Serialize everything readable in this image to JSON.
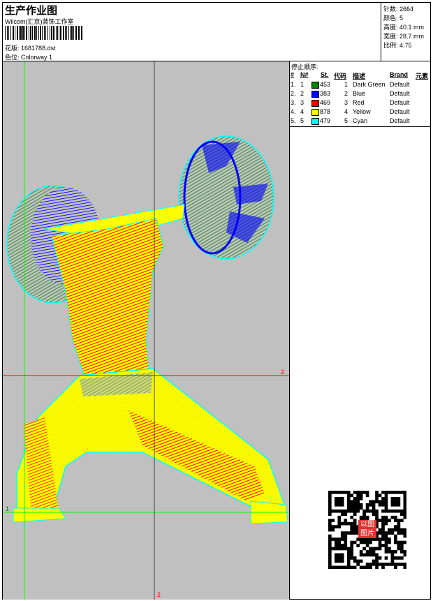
{
  "header": {
    "title": "生产作业图",
    "company": "Wilcom(汇京)装饰工作室",
    "design_label": "花版:",
    "design_value": "1681788.dst",
    "colorway_label": "色位:",
    "colorway_value": "Colorway 1"
  },
  "stats": [
    {
      "label": "针数:",
      "value": "2664"
    },
    {
      "label": "颜色:",
      "value": "5"
    },
    {
      "label": "高度:",
      "value": "40.1 mm"
    },
    {
      "label": "宽度:",
      "value": "28.7 mm"
    },
    {
      "label": "比例:",
      "value": "4.75"
    }
  ],
  "canvas": {
    "marker_h": "2",
    "marker_v": "2",
    "marker_origin": "1"
  },
  "stop_sequence": {
    "caption": "停止顺序:",
    "headers": [
      "#",
      "N#",
      "St.",
      "代码",
      "描述",
      "Brand",
      "元素"
    ],
    "rows": [
      {
        "idx": "1.",
        "n": "1",
        "color": "#008000",
        "st": "453",
        "code": "1",
        "desc": "Dark Green",
        "brand": "Default"
      },
      {
        "idx": "2.",
        "n": "2",
        "color": "#0000ff",
        "st": "383",
        "code": "2",
        "desc": "Blue",
        "brand": "Default"
      },
      {
        "idx": "3.",
        "n": "3",
        "color": "#ff0000",
        "st": "469",
        "code": "3",
        "desc": "Red",
        "brand": "Default"
      },
      {
        "idx": "4.",
        "n": "4",
        "color": "#ffff00",
        "st": "878",
        "code": "4",
        "desc": "Yellow",
        "brand": "Default"
      },
      {
        "idx": "5.",
        "n": "5",
        "color": "#00ffff",
        "st": "479",
        "code": "5",
        "desc": "Cyan",
        "brand": "Default"
      }
    ]
  },
  "qr": {
    "center_text": "以图图片"
  }
}
